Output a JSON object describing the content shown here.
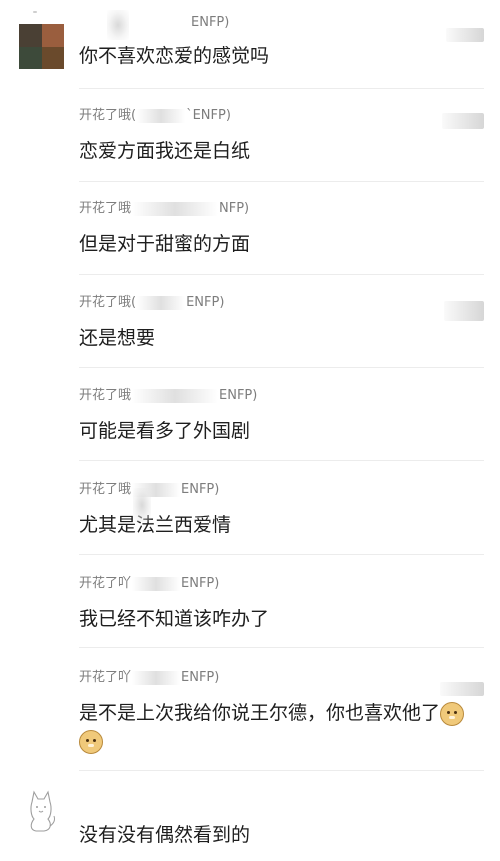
{
  "comments": [
    {
      "name_prefix": "",
      "name_suffix": "ENFP)",
      "text": "你不喜欢恋爱的感觉吗"
    },
    {
      "name_prefix": "开花了哦(",
      "name_suffix": "`ENFP)",
      "text": "恋爱方面我还是白纸"
    },
    {
      "name_prefix": "开花了哦",
      "name_suffix": "NFP)",
      "text": "但是对于甜蜜的方面"
    },
    {
      "name_prefix": "开花了哦(",
      "name_suffix": "ENFP)",
      "text": "还是想要"
    },
    {
      "name_prefix": "开花了哦",
      "name_suffix": "ENFP)",
      "text": "可能是看多了外国剧"
    },
    {
      "name_prefix": "开花了哦",
      "name_suffix": "ENFP)",
      "text": "尤其是法兰西爱情"
    },
    {
      "name_prefix": "开花了吖",
      "name_suffix": "ENFP)",
      "text": "我已经不知道该咋办了"
    },
    {
      "name_prefix": "开花了吖",
      "name_suffix": "ENFP)",
      "text": "是不是上次我给你说王尔德，你也喜欢他了"
    },
    {
      "name_prefix": "",
      "name_suffix": "",
      "text": "没有没有偶然看到的"
    }
  ],
  "emojis": [
    "doge-emoji",
    "doge-emoji"
  ]
}
